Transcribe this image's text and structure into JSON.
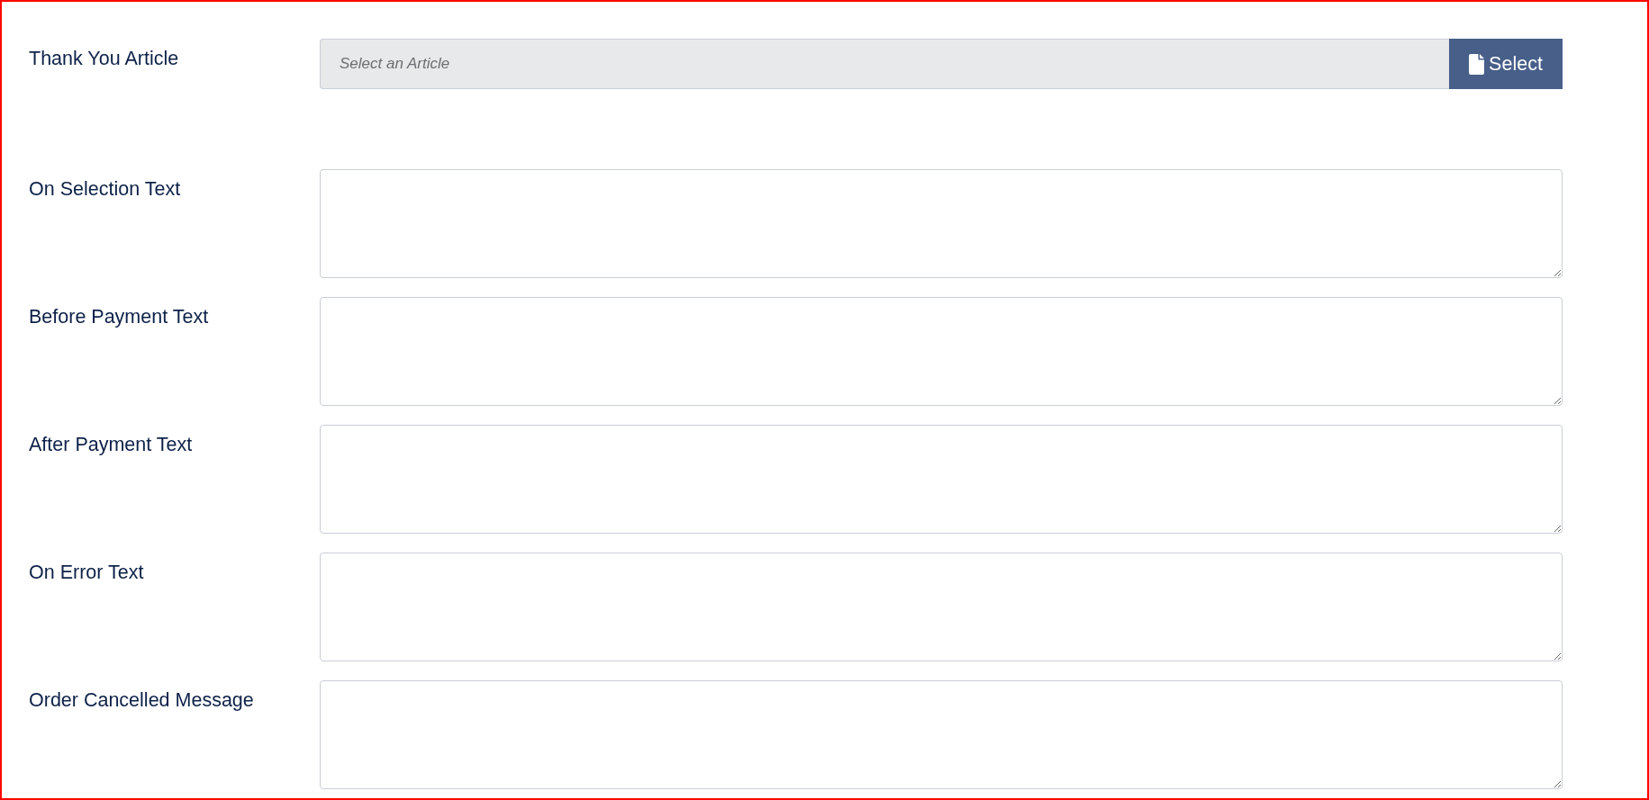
{
  "fields": [
    {
      "kind": "article-picker",
      "label": "Thank You Article",
      "placeholder": "Select an Article",
      "button": "Select"
    },
    {
      "kind": "textarea",
      "label": "On Selection Text"
    },
    {
      "kind": "textarea",
      "label": "Before Payment Text"
    },
    {
      "kind": "textarea",
      "label": "After Payment Text"
    },
    {
      "kind": "textarea",
      "label": "On Error Text"
    },
    {
      "kind": "textarea",
      "label": "Order Cancelled Message"
    }
  ]
}
